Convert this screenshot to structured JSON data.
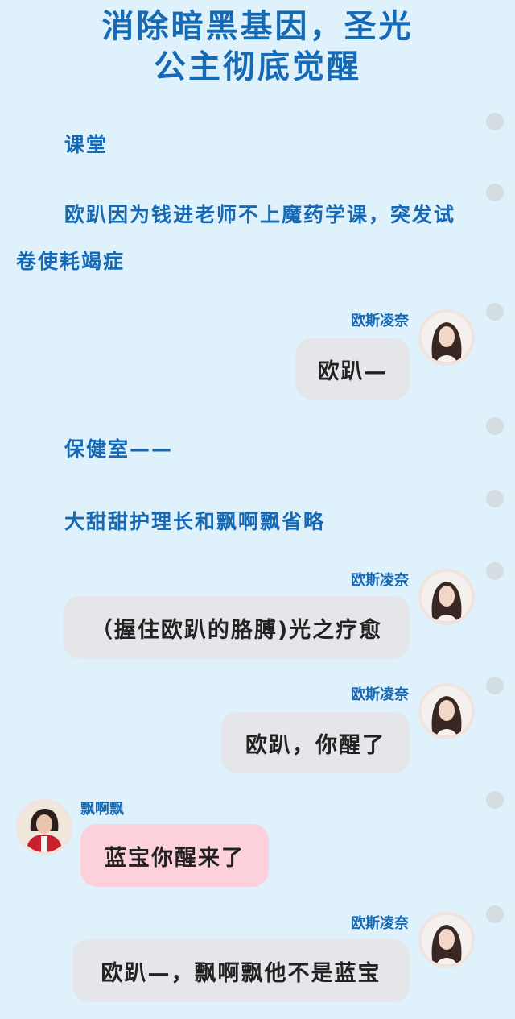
{
  "title": {
    "line1": "消除暗黑基因，圣光",
    "line2": "公主彻底觉醒"
  },
  "narration": [
    {
      "text": "课堂"
    },
    {
      "text": "欧趴因为钱进老师不上魔药学课，突发试卷使耗竭症"
    },
    {
      "text": "保健室——"
    },
    {
      "text": "大甜甜护理长和飘啊飘省略"
    }
  ],
  "messages": [
    {
      "speaker": "欧斯凌奈",
      "text": "欧趴—",
      "side": "right",
      "color": "gray"
    },
    {
      "speaker": "欧斯凌奈",
      "text": "（握住欧趴的胳膊)光之疗愈",
      "side": "right",
      "color": "gray"
    },
    {
      "speaker": "欧斯凌奈",
      "text": "欧趴，你醒了",
      "side": "right",
      "color": "gray"
    },
    {
      "speaker": "飘啊飘",
      "text": "蓝宝你醒来了",
      "side": "left",
      "color": "pink"
    },
    {
      "speaker": "欧斯凌奈",
      "text": "欧趴—，飘啊飘他不是蓝宝",
      "side": "right",
      "color": "gray"
    }
  ],
  "colors": {
    "background": "#dff1fb",
    "accent": "#1569b5",
    "bubble_gray": "#e4e6ea",
    "bubble_pink": "#fcd1dc",
    "rail_dot": "#d4dde2"
  },
  "icons": {
    "avatar_right": "girl-portrait-avatar",
    "avatar_left": "red-jacket-avatar"
  }
}
